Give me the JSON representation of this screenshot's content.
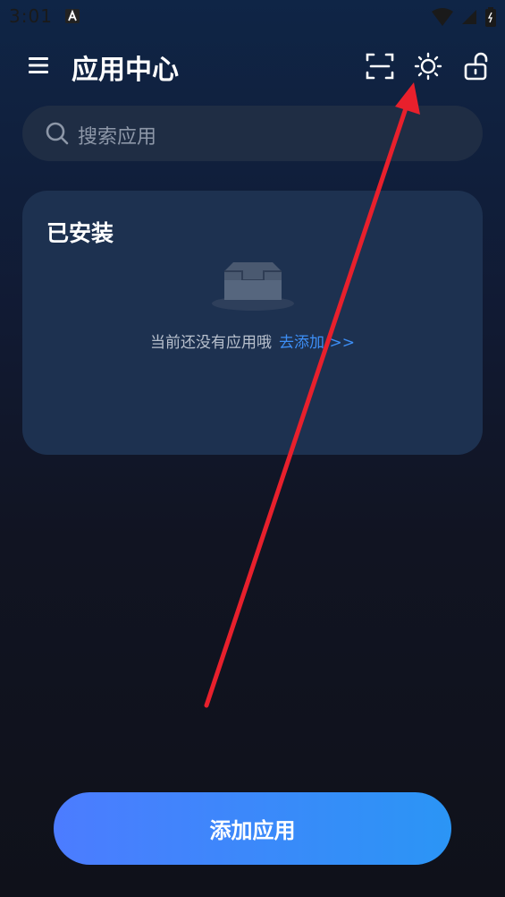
{
  "status_bar": {
    "time": "3:01"
  },
  "header": {
    "title": "应用中心",
    "icons": [
      "menu-icon",
      "scan-icon",
      "brightness-icon",
      "unlock-icon"
    ]
  },
  "search": {
    "placeholder": "搜索应用"
  },
  "installed": {
    "title": "已安装",
    "empty_text": "当前还没有应用哦",
    "add_link": "去添加 >>"
  },
  "bottom": {
    "add_button": "添加应用"
  },
  "colors": {
    "accent": "#3d8ef5",
    "arrow": "#e8202c",
    "button_gradient_start": "#4c7cff",
    "button_gradient_end": "#2b95f5"
  }
}
